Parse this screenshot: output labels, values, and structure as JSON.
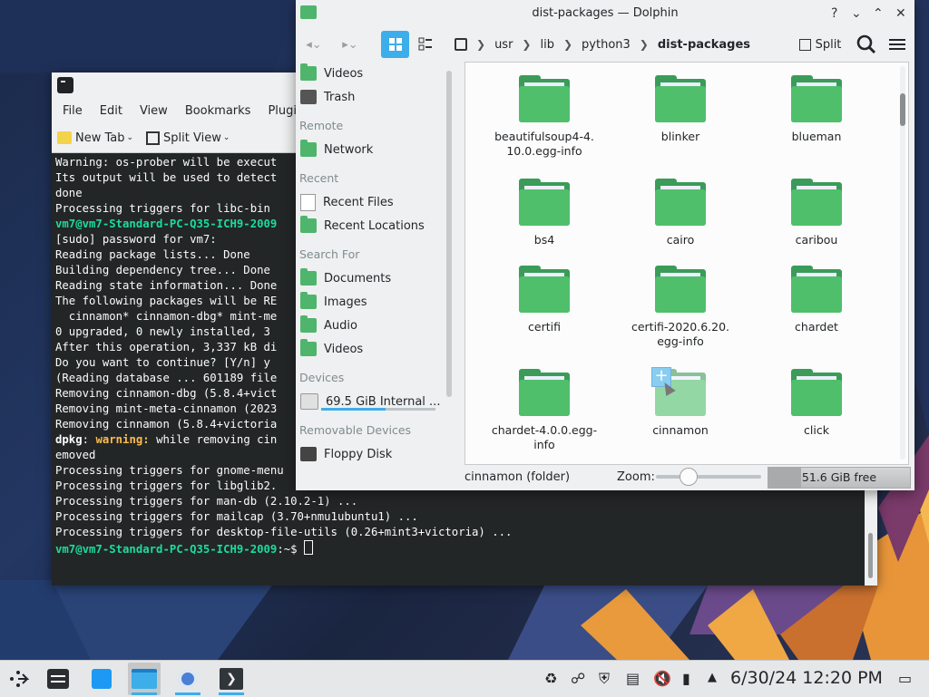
{
  "konsole": {
    "menu": [
      "File",
      "Edit",
      "View",
      "Bookmarks",
      "Plugins"
    ],
    "toolbar": {
      "new_tab": "New Tab",
      "split_view": "Split View"
    },
    "lines": [
      {
        "parts": [
          {
            "t": "Warning: os-prober will be execut"
          }
        ]
      },
      {
        "parts": [
          {
            "t": "Its output will be used to detect"
          }
        ]
      },
      {
        "parts": [
          {
            "t": "done"
          }
        ]
      },
      {
        "parts": [
          {
            "t": "Processing triggers for libc-bin "
          }
        ]
      },
      {
        "parts": [
          {
            "t": "vm7@vm7-Standard-PC-Q35-ICH9-2009",
            "c": "pr"
          }
        ]
      },
      {
        "parts": [
          {
            "t": "[sudo] password for vm7:"
          }
        ]
      },
      {
        "parts": [
          {
            "t": "Reading package lists... Done"
          }
        ]
      },
      {
        "parts": [
          {
            "t": "Building dependency tree... Done"
          }
        ]
      },
      {
        "parts": [
          {
            "t": "Reading state information... Done"
          }
        ]
      },
      {
        "parts": [
          {
            "t": "The following packages will be RE"
          }
        ]
      },
      {
        "parts": [
          {
            "t": "  cinnamon* cinnamon-dbg* mint-me"
          }
        ]
      },
      {
        "parts": [
          {
            "t": "0 upgraded, 0 newly installed, 3 "
          }
        ]
      },
      {
        "parts": [
          {
            "t": "After this operation, 3,337 kB di"
          }
        ]
      },
      {
        "parts": [
          {
            "t": "Do you want to continue? [Y/n] y"
          }
        ]
      },
      {
        "parts": [
          {
            "t": "(Reading database ... 601189 file"
          }
        ]
      },
      {
        "parts": [
          {
            "t": "Removing cinnamon-dbg (5.8.4+vict"
          }
        ]
      },
      {
        "parts": [
          {
            "t": "Removing mint-meta-cinnamon (2023"
          }
        ]
      },
      {
        "parts": [
          {
            "t": "Removing cinnamon (5.8.4+victoria"
          }
        ]
      },
      {
        "parts": [
          {
            "t": "dpkg",
            "c": "b"
          },
          {
            "t": ": "
          },
          {
            "t": "warning:",
            "c": "warn"
          },
          {
            "t": " while removing cin"
          }
        ]
      },
      {
        "parts": [
          {
            "t": "emoved"
          }
        ]
      },
      {
        "parts": [
          {
            "t": "Processing triggers for gnome-menu"
          }
        ]
      },
      {
        "parts": [
          {
            "t": "Processing triggers for libglib2."
          }
        ]
      },
      {
        "parts": [
          {
            "t": "Processing triggers for man-db (2.10.2-1) ..."
          }
        ]
      },
      {
        "parts": [
          {
            "t": "Processing triggers for mailcap (3.70+nmu1ubuntu1) ..."
          }
        ]
      },
      {
        "parts": [
          {
            "t": "Processing triggers for desktop-file-utils (0.26+mint3+victoria) ..."
          }
        ]
      },
      {
        "parts": [
          {
            "t": "vm7@vm7-Standard-PC-Q35-ICH9-2009",
            "c": "pr"
          },
          {
            "t": ":~$ "
          }
        ],
        "cursor": true
      }
    ]
  },
  "dolphin": {
    "title": "dist-packages — Dolphin",
    "split_label": "Split",
    "breadcrumbs": [
      "usr",
      "lib",
      "python3"
    ],
    "current_folder": "dist-packages",
    "places": [
      {
        "type": "item",
        "label": "Videos",
        "icon": "folder"
      },
      {
        "type": "item",
        "label": "Trash",
        "icon": "trash"
      },
      {
        "type": "head",
        "label": "Remote"
      },
      {
        "type": "item",
        "label": "Network",
        "icon": "folder"
      },
      {
        "type": "head",
        "label": "Recent"
      },
      {
        "type": "item",
        "label": "Recent Files",
        "icon": "doc"
      },
      {
        "type": "item",
        "label": "Recent Locations",
        "icon": "folder"
      },
      {
        "type": "head",
        "label": "Search For"
      },
      {
        "type": "item",
        "label": "Documents",
        "icon": "folder"
      },
      {
        "type": "item",
        "label": "Images",
        "icon": "folder"
      },
      {
        "type": "item",
        "label": "Audio",
        "icon": "folder"
      },
      {
        "type": "item",
        "label": "Videos",
        "icon": "folder"
      },
      {
        "type": "head",
        "label": "Devices"
      },
      {
        "type": "item",
        "label": "69.5 GiB Internal ...",
        "icon": "drive",
        "usage": 0.56
      },
      {
        "type": "head",
        "label": "Removable Devices"
      },
      {
        "type": "item",
        "label": "Floppy Disk",
        "icon": "floppy"
      }
    ],
    "files": [
      {
        "name": "beautifulsoup4-4.\n10.0.egg-info"
      },
      {
        "name": "blinker"
      },
      {
        "name": "blueman"
      },
      {
        "name": "bs4"
      },
      {
        "name": "cairo"
      },
      {
        "name": "caribou"
      },
      {
        "name": "certifi"
      },
      {
        "name": "certifi-2020.6.20.\negg-info"
      },
      {
        "name": "chardet"
      },
      {
        "name": "chardet-4.0.0.egg-\ninfo"
      },
      {
        "name": "cinnamon",
        "selected": true
      },
      {
        "name": "click"
      }
    ],
    "status": {
      "selection": "cinnamon (folder)",
      "zoom_label": "Zoom:",
      "free_space": "51.6 GiB free",
      "zoom_level": 0.3
    }
  },
  "taskbar": {
    "clock": "6/30/24 12:20 PM"
  }
}
